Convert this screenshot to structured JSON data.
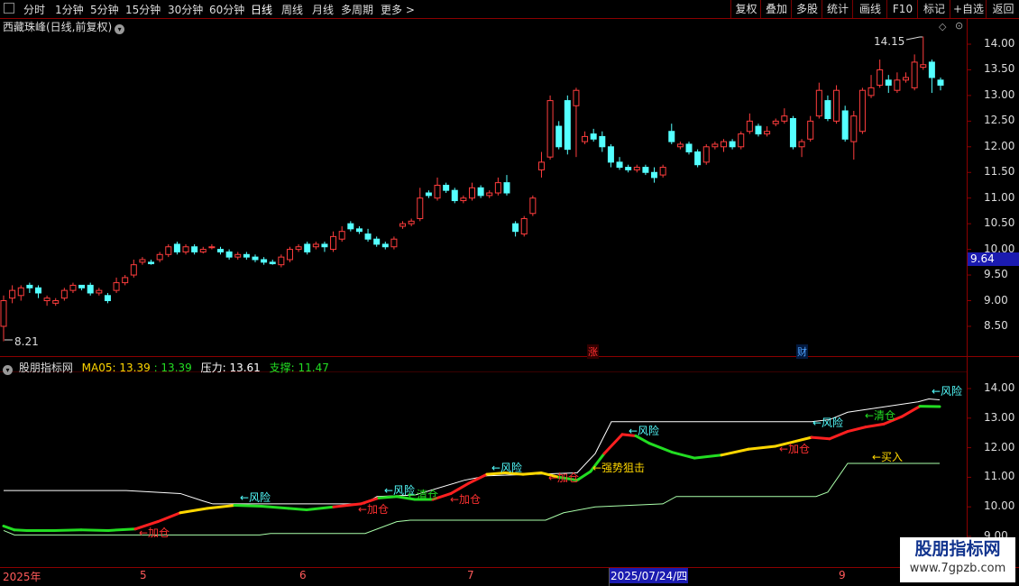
{
  "toolbar": {
    "periods": [
      "分时",
      "1分钟",
      "5分钟",
      "15分钟",
      "30分钟",
      "60分钟",
      "日线",
      "周线",
      "月线",
      "多周期",
      "更多 >"
    ],
    "active_period": "日线",
    "right_buttons": [
      "复权",
      "叠加",
      "多股",
      "统计",
      "画线",
      "F10",
      "标记",
      "+自选",
      "返回"
    ]
  },
  "stock": {
    "title": "西藏珠峰(日线,前复权)",
    "menu_icon": "chevron-down-icon"
  },
  "price_panel": {
    "y_ticks": [
      "14.00",
      "13.50",
      "13.00",
      "12.50",
      "12.00",
      "11.50",
      "11.00",
      "10.50",
      "10.00",
      "9.50",
      "9.00",
      "8.50"
    ],
    "current_price": "9.64",
    "high_label": "14.15",
    "low_label": "8.21",
    "markers": [
      {
        "text": "涨",
        "color": "#ff3030"
      },
      {
        "text": "财",
        "color": "#4fa3ff"
      }
    ]
  },
  "indicator": {
    "name": "股朋指标网",
    "ma_label": "MA05:",
    "ma_value1": "13.39",
    "ma_value2": ": 13.39",
    "pressure_label": "压力: 13.61",
    "support_label": "支撑: 11.47",
    "y_ticks": [
      "14.00",
      "13.00",
      "12.00",
      "11.00",
      "10.00",
      "9.00"
    ],
    "signals": {
      "risk": "←风险",
      "clear": "←清仓",
      "add": "←加仓",
      "buy": "←买入",
      "snipe": "←强势狙击"
    }
  },
  "date_axis": {
    "labels": [
      "2025年",
      "5",
      "6",
      "7",
      "2025/07/24/四",
      "9"
    ]
  },
  "watermark": {
    "title": "股朋指标网",
    "url": "www.7gpzb.com"
  },
  "colors": {
    "up": "#ff3d3d",
    "down": "#54ffff",
    "border": "#8b0000",
    "green": "#22dd22",
    "yellow": "#ffd700"
  },
  "chart_data": {
    "type": "candlestick",
    "title": "西藏珠峰(日线,前复权)",
    "y_range": [
      8.2,
      14.35
    ],
    "high": 14.15,
    "low": 8.21,
    "indicator_range": [
      9.0,
      14.3
    ],
    "ma05_last": 13.39,
    "pressure": 13.61,
    "support": 11.47
  }
}
